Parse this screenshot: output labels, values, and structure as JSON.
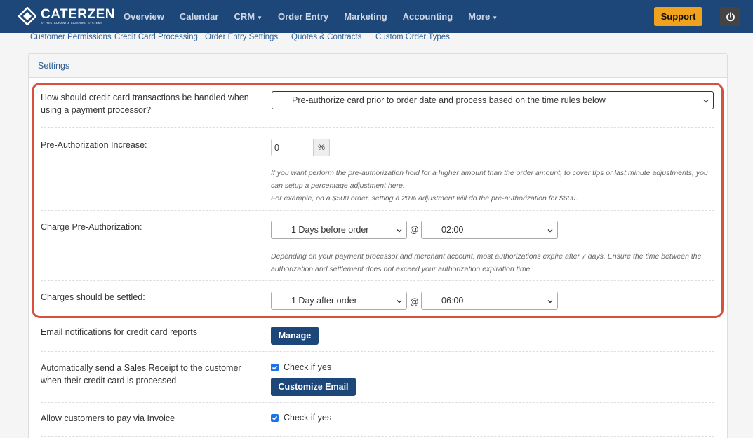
{
  "app": {
    "logo_name": "CATERZEN",
    "logo_tagline": "BY RESTAURANT & CATERING SYSTEMS"
  },
  "nav": {
    "items": [
      {
        "label": "Overview"
      },
      {
        "label": "Calendar"
      },
      {
        "label": "CRM",
        "dropdown": true
      },
      {
        "label": "Order Entry"
      },
      {
        "label": "Marketing"
      },
      {
        "label": "Accounting"
      },
      {
        "label": "More",
        "dropdown": true
      }
    ],
    "support_label": "Support",
    "power_icon": "power-icon"
  },
  "subnav": {
    "items": [
      {
        "label": "Customer Permissions"
      },
      {
        "label": "Credit Card Processing"
      },
      {
        "label": "Order Entry Settings"
      },
      {
        "label": "Quotes & Contracts"
      },
      {
        "label": "Custom Order Types"
      }
    ]
  },
  "panel": {
    "title": "Settings"
  },
  "settings": {
    "cc_handling": {
      "label": "How should credit card transactions be handled when using a payment processor?",
      "value": "Pre-authorize card prior to order date and process based on the time rules below"
    },
    "preauth_increase": {
      "label": "Pre-Authorization Increase:",
      "value": "0",
      "unit": "%",
      "help_1": "If you want perform the pre-authorization hold for a higher amount than the order amount, to cover tips or last minute adjustments, you can setup a percentage adjustment here.",
      "help_2": "For example, on a $500 order, setting a 20% adjustment will do the pre-authorization for $600."
    },
    "charge_preauth": {
      "label": "Charge Pre-Authorization:",
      "day_value": "1 Days before order",
      "at": "@",
      "time_value": "02:00",
      "help": "Depending on your payment processor and merchant account, most authorizations expire after 7 days. Ensure the time between the authorization and settlement does not exceed your authorization expiration time."
    },
    "settle": {
      "label": "Charges should be settled:",
      "day_value": "1 Day after order",
      "at": "@",
      "time_value": "06:00"
    },
    "email_notifications": {
      "label": "Email notifications for credit card reports",
      "button": "Manage"
    },
    "sales_receipt": {
      "label": "Automatically send a Sales Receipt to the customer when their credit card is processed",
      "check_label": "Check if yes",
      "checked": true,
      "button": "Customize Email"
    },
    "invoice": {
      "label": "Allow customers to pay via Invoice",
      "check_label": "Check if yes",
      "checked": true
    }
  },
  "colors": {
    "nav_bg": "#1d4679",
    "support": "#f0a21f",
    "highlight": "#d9503f",
    "checkbox": "#1a73e8"
  }
}
